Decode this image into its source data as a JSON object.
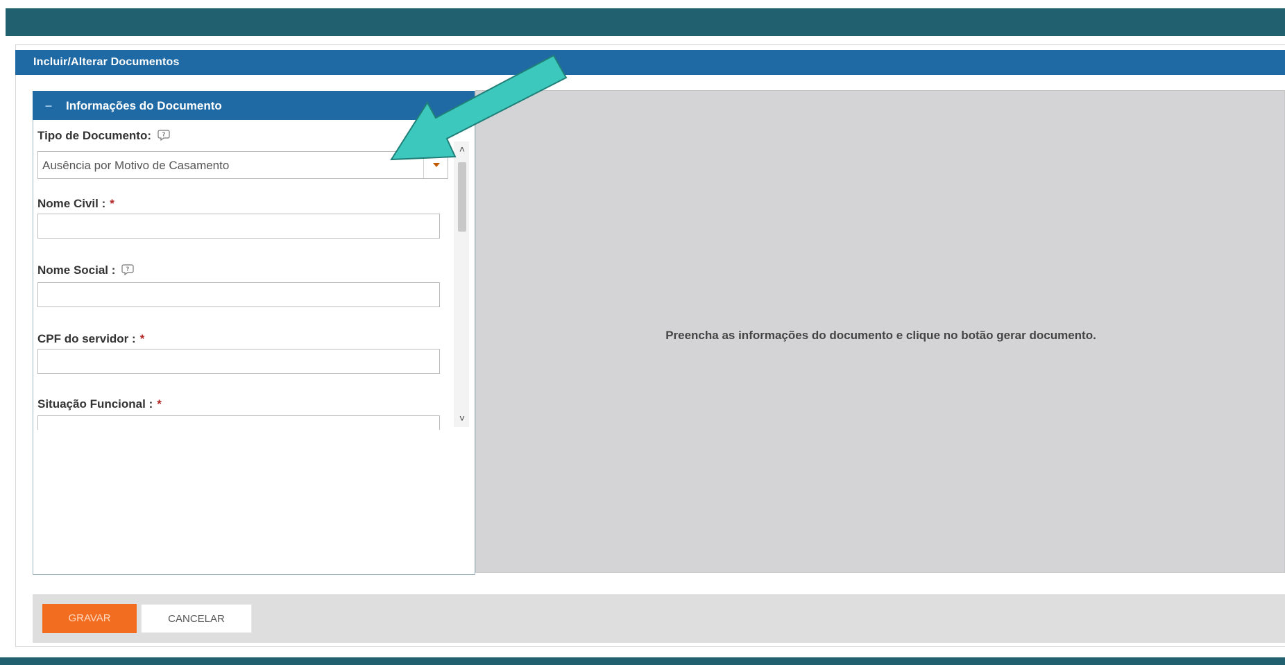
{
  "panel": {
    "title": "Incluir/Alterar Documentos"
  },
  "document_info": {
    "header": "Informações do Documento",
    "collapse_symbol": "–",
    "fields": {
      "tipo_documento": {
        "label": "Tipo de Documento:",
        "value": "Ausência por Motivo de Casamento"
      },
      "nome_civil": {
        "label": "Nome Civil :",
        "required_mark": "*",
        "value": ""
      },
      "nome_social": {
        "label": "Nome Social :",
        "value": ""
      },
      "cpf": {
        "label": "CPF do servidor :",
        "required_mark": "*",
        "value": ""
      },
      "situacao_funcional": {
        "label": "Situação Funcional :",
        "required_mark": "*",
        "value": ""
      }
    }
  },
  "preview": {
    "message": "Preencha as informações do documento e clique no botão gerar documento."
  },
  "actions": {
    "save_label": "GRAVAR",
    "cancel_label": "CANCELAR"
  },
  "colors": {
    "brand_dark": "#21606f",
    "header_blue": "#1f6aa5",
    "save_orange": "#f36d21",
    "arrow_teal": "#3cc8bd"
  }
}
